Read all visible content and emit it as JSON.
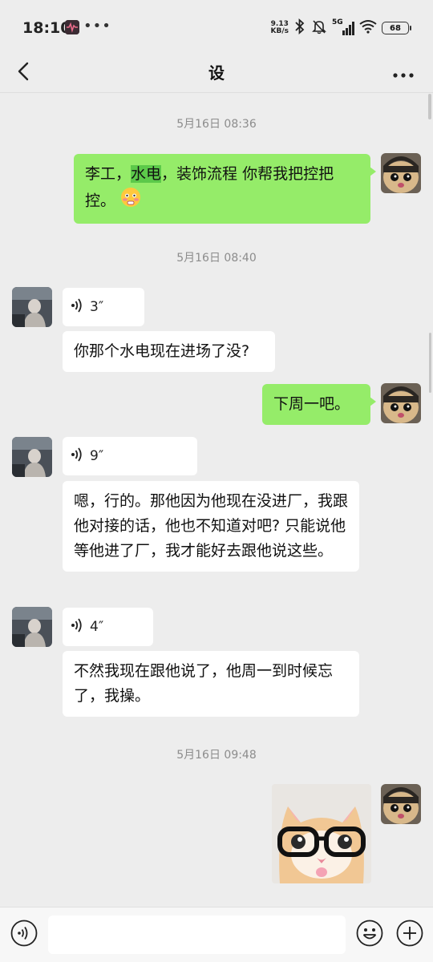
{
  "status_bar": {
    "time": "18:10",
    "more": "•••",
    "net_speed_value": "9.13",
    "net_speed_unit": "KB/s",
    "network_type": "5G",
    "battery": "68",
    "icons": [
      "app-notification-icon",
      "bluetooth-icon",
      "mute-bell-icon",
      "signal-icon",
      "wifi-icon",
      "battery-icon"
    ]
  },
  "nav": {
    "title": "设",
    "back_icon": "chevron-left-icon",
    "more_icon": "more-horizontal-icon"
  },
  "messages": {
    "ts1": "5月16日 08:36",
    "m1_part1": "李工，",
    "m1_highlight": "水电",
    "m1_part2": "，装饰流程 你帮我把控把控。",
    "m1_emoji": "flushed-emoji",
    "ts2": "5月16日 08:40",
    "v1_duration": "3″",
    "m2": "你那个水电现在进场了没?",
    "m3": "下周一吧。",
    "v2_duration": "9″",
    "m4": "嗯，行的。那他因为他现在没进厂，我跟他对接的话，他也不知道对吧? 只能说他等他进了厂，我才能好去跟他说这些。",
    "v3_duration": "4″",
    "m5": "不然我现在跟他说了，他周一到时候忘了，我操。",
    "ts3": "5月16日 09:48",
    "sticker": "cat-with-glasses-sticker"
  },
  "input_bar": {
    "voice_icon": "voice-input-icon",
    "emoji_icon": "emoji-icon",
    "plus_icon": "plus-circle-icon",
    "value": ""
  },
  "colors": {
    "background": "#ededed",
    "outgoing_bubble": "#95ec69",
    "incoming_bubble": "#ffffff",
    "highlight": "#5cc94a",
    "timestamp": "#8c8c8c"
  }
}
